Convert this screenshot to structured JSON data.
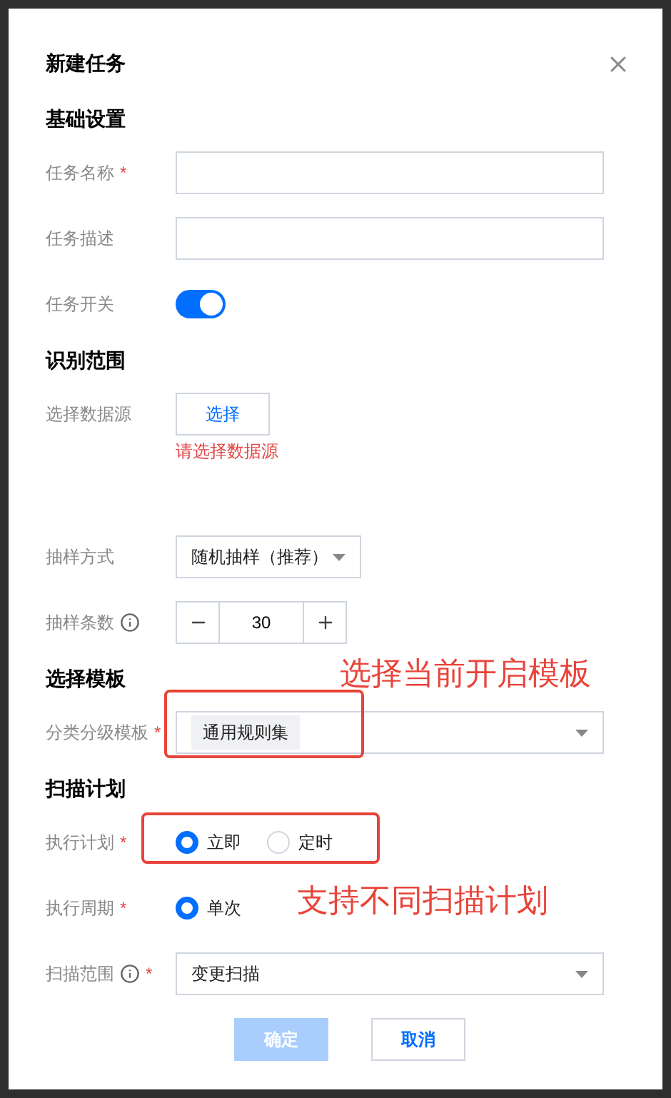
{
  "dialog": {
    "title": "新建任务"
  },
  "sections": [
    {
      "title": "基础设置",
      "fields": [
        {
          "kind": "text",
          "label": "任务名称",
          "mark": "*"
        },
        {
          "kind": "text",
          "label": "任务描述"
        },
        {
          "kind": "switch",
          "label": "任务开关",
          "on": true
        }
      ]
    },
    {
      "title": "识别范围",
      "fields": [
        {
          "kind": "picker",
          "label": "选择数据源",
          "button": "选择",
          "error": "请选择数据源"
        },
        {
          "kind": "short-select",
          "label": "抽样方式",
          "value": "随机抽样（推荐）"
        },
        {
          "kind": "stepper",
          "label": "抽样条数",
          "info": true,
          "value": "30"
        }
      ]
    },
    {
      "title": "选择模板",
      "fields": [
        {
          "kind": "tags",
          "label": "分类分级模板",
          "mark": "*",
          "tags": [
            "通用规则集"
          ]
        }
      ]
    },
    {
      "title": "扫描计划",
      "fields": [
        {
          "kind": "radio",
          "label": "执行计划",
          "mark": "*",
          "options": [
            {
              "label": "立即",
              "selected": true
            },
            {
              "label": "定时",
              "selected": false
            }
          ]
        },
        {
          "kind": "radio",
          "label": "执行周期",
          "mark": "*",
          "options": [
            {
              "label": "单次",
              "selected": true
            }
          ]
        },
        {
          "kind": "select",
          "label": "扫描范围",
          "info": true,
          "mark": "*",
          "value": "变更扫描"
        }
      ]
    }
  ],
  "buttons": [
    {
      "label": "确定",
      "kind": "primary",
      "disabled": true
    },
    {
      "label": "取消",
      "kind": "secondary",
      "disabled": false
    }
  ],
  "annotations": [
    {
      "text": "选择当前开启模板"
    },
    {
      "text": "支持不同扫描计划"
    }
  ]
}
